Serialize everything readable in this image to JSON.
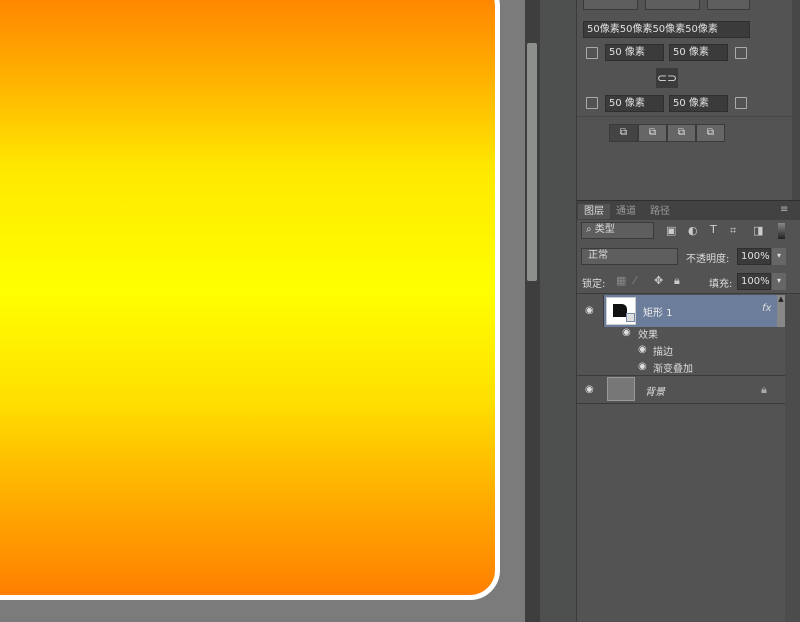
{
  "properties": {
    "combined_radius": "50像素50像素50像素50像素",
    "radius_top_left": "50 像素",
    "radius_top_right": "50 像素",
    "radius_bottom_left": "50 像素",
    "radius_bottom_right": "50 像素"
  },
  "layers_panel": {
    "tabs": [
      "图层",
      "通道",
      "路径"
    ],
    "filter_kind": "类型",
    "blend_mode": "正常",
    "opacity_label": "不透明度:",
    "opacity_value": "100%",
    "lock_label": "锁定:",
    "fill_label": "填充:",
    "fill_value": "100%",
    "layers": [
      {
        "name": "矩形 1",
        "fx": "fx",
        "effects_label": "效果",
        "effects": [
          "描边",
          "渐变叠加"
        ]
      },
      {
        "name": "背景"
      }
    ]
  },
  "colors": {
    "gradient_edge": "#ff7f00",
    "gradient_center": "#ffff00",
    "panel": "#535353",
    "selected_layer": "#6b7d9a"
  }
}
